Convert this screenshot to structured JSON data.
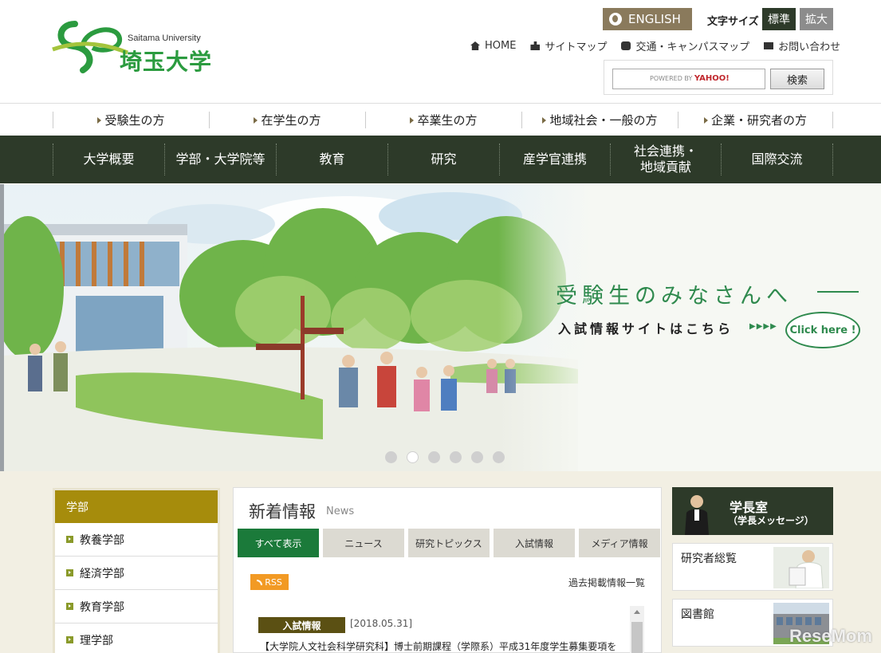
{
  "header": {
    "logo_en": "Saitama University",
    "logo_ja": "埼玉大学",
    "english_label": "ENGLISH",
    "fontsize_label": "文字サイズ",
    "fontsize_standard": "標準",
    "fontsize_large": "拡大",
    "util_links": [
      {
        "label": "HOME",
        "icon": "home-icon"
      },
      {
        "label": "サイトマップ",
        "icon": "sitemap-icon"
      },
      {
        "label": "交通・キャンパスマップ",
        "icon": "bus-icon"
      },
      {
        "label": "お問い合わせ",
        "icon": "mail-icon"
      }
    ],
    "search_placeholder": "POWERED BY",
    "search_brand": "YAHOO!",
    "search_button": "検索"
  },
  "audience_nav": [
    "受験生の方",
    "在学生の方",
    "卒業生の方",
    "地域社会・一般の方",
    "企業・研究者の方"
  ],
  "main_nav": [
    "大学概要",
    "学部・大学院等",
    "教育",
    "研究",
    "産学官連携",
    "社会連携・\n地域貢献",
    "国際交流"
  ],
  "hero": {
    "title": "受験生のみなさんへ",
    "subtitle": "入試情報サイトはこちら",
    "arrows": "▶▶▶▶",
    "click_label": "Click here !",
    "slide_count": 6,
    "active_slide": 2
  },
  "left_menu": {
    "heading": "学部",
    "items": [
      "教養学部",
      "経済学部",
      "教育学部",
      "理学部"
    ]
  },
  "news": {
    "title": "新着情報",
    "title_en": "News",
    "tabs": [
      "すべて表示",
      "ニュース",
      "研究トピックス",
      "入試情報",
      "メディア情報"
    ],
    "rss_label": "RSS",
    "archive_label": "過去掲載情報一覧",
    "items": [
      {
        "tag": "入試情報",
        "date": "[2018.05.31]",
        "text": "【大学院人文社会科学研究科】博士前期課程（学際系）平成31年度学生募集要項を"
      }
    ]
  },
  "right_col": {
    "president_title": "学長室",
    "president_sub": "（学長メッセージ）",
    "boxes": [
      "研究者総覧",
      "図書館"
    ]
  },
  "watermark": "ReseMom",
  "colors": {
    "brand_green": "#2b9b3f",
    "nav_dark": "#2d3a29",
    "tab_active": "#1b7a3a",
    "menu_gold": "#a68c0c",
    "rss_orange": "#f29a24"
  }
}
